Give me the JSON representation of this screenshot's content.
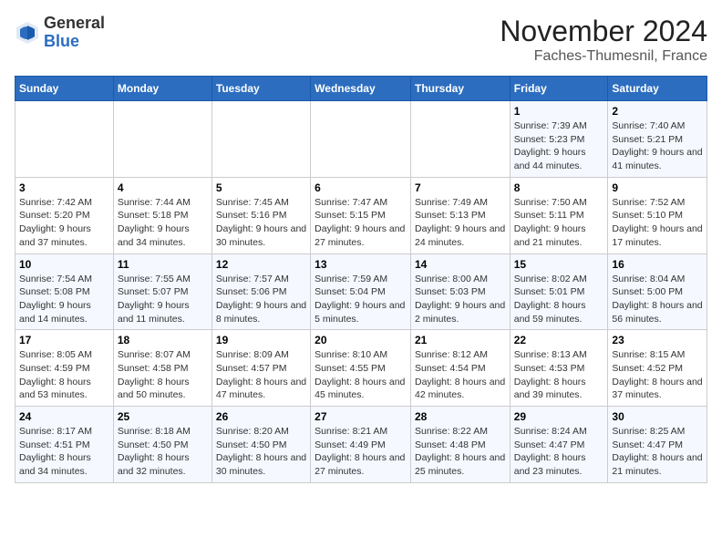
{
  "header": {
    "logo_general": "General",
    "logo_blue": "Blue",
    "month_title": "November 2024",
    "location": "Faches-Thumesnil, France"
  },
  "days_of_week": [
    "Sunday",
    "Monday",
    "Tuesday",
    "Wednesday",
    "Thursday",
    "Friday",
    "Saturday"
  ],
  "weeks": [
    [
      {
        "day": "",
        "info": ""
      },
      {
        "day": "",
        "info": ""
      },
      {
        "day": "",
        "info": ""
      },
      {
        "day": "",
        "info": ""
      },
      {
        "day": "",
        "info": ""
      },
      {
        "day": "1",
        "info": "Sunrise: 7:39 AM\nSunset: 5:23 PM\nDaylight: 9 hours and 44 minutes."
      },
      {
        "day": "2",
        "info": "Sunrise: 7:40 AM\nSunset: 5:21 PM\nDaylight: 9 hours and 41 minutes."
      }
    ],
    [
      {
        "day": "3",
        "info": "Sunrise: 7:42 AM\nSunset: 5:20 PM\nDaylight: 9 hours and 37 minutes."
      },
      {
        "day": "4",
        "info": "Sunrise: 7:44 AM\nSunset: 5:18 PM\nDaylight: 9 hours and 34 minutes."
      },
      {
        "day": "5",
        "info": "Sunrise: 7:45 AM\nSunset: 5:16 PM\nDaylight: 9 hours and 30 minutes."
      },
      {
        "day": "6",
        "info": "Sunrise: 7:47 AM\nSunset: 5:15 PM\nDaylight: 9 hours and 27 minutes."
      },
      {
        "day": "7",
        "info": "Sunrise: 7:49 AM\nSunset: 5:13 PM\nDaylight: 9 hours and 24 minutes."
      },
      {
        "day": "8",
        "info": "Sunrise: 7:50 AM\nSunset: 5:11 PM\nDaylight: 9 hours and 21 minutes."
      },
      {
        "day": "9",
        "info": "Sunrise: 7:52 AM\nSunset: 5:10 PM\nDaylight: 9 hours and 17 minutes."
      }
    ],
    [
      {
        "day": "10",
        "info": "Sunrise: 7:54 AM\nSunset: 5:08 PM\nDaylight: 9 hours and 14 minutes."
      },
      {
        "day": "11",
        "info": "Sunrise: 7:55 AM\nSunset: 5:07 PM\nDaylight: 9 hours and 11 minutes."
      },
      {
        "day": "12",
        "info": "Sunrise: 7:57 AM\nSunset: 5:06 PM\nDaylight: 9 hours and 8 minutes."
      },
      {
        "day": "13",
        "info": "Sunrise: 7:59 AM\nSunset: 5:04 PM\nDaylight: 9 hours and 5 minutes."
      },
      {
        "day": "14",
        "info": "Sunrise: 8:00 AM\nSunset: 5:03 PM\nDaylight: 9 hours and 2 minutes."
      },
      {
        "day": "15",
        "info": "Sunrise: 8:02 AM\nSunset: 5:01 PM\nDaylight: 8 hours and 59 minutes."
      },
      {
        "day": "16",
        "info": "Sunrise: 8:04 AM\nSunset: 5:00 PM\nDaylight: 8 hours and 56 minutes."
      }
    ],
    [
      {
        "day": "17",
        "info": "Sunrise: 8:05 AM\nSunset: 4:59 PM\nDaylight: 8 hours and 53 minutes."
      },
      {
        "day": "18",
        "info": "Sunrise: 8:07 AM\nSunset: 4:58 PM\nDaylight: 8 hours and 50 minutes."
      },
      {
        "day": "19",
        "info": "Sunrise: 8:09 AM\nSunset: 4:57 PM\nDaylight: 8 hours and 47 minutes."
      },
      {
        "day": "20",
        "info": "Sunrise: 8:10 AM\nSunset: 4:55 PM\nDaylight: 8 hours and 45 minutes."
      },
      {
        "day": "21",
        "info": "Sunrise: 8:12 AM\nSunset: 4:54 PM\nDaylight: 8 hours and 42 minutes."
      },
      {
        "day": "22",
        "info": "Sunrise: 8:13 AM\nSunset: 4:53 PM\nDaylight: 8 hours and 39 minutes."
      },
      {
        "day": "23",
        "info": "Sunrise: 8:15 AM\nSunset: 4:52 PM\nDaylight: 8 hours and 37 minutes."
      }
    ],
    [
      {
        "day": "24",
        "info": "Sunrise: 8:17 AM\nSunset: 4:51 PM\nDaylight: 8 hours and 34 minutes."
      },
      {
        "day": "25",
        "info": "Sunrise: 8:18 AM\nSunset: 4:50 PM\nDaylight: 8 hours and 32 minutes."
      },
      {
        "day": "26",
        "info": "Sunrise: 8:20 AM\nSunset: 4:50 PM\nDaylight: 8 hours and 30 minutes."
      },
      {
        "day": "27",
        "info": "Sunrise: 8:21 AM\nSunset: 4:49 PM\nDaylight: 8 hours and 27 minutes."
      },
      {
        "day": "28",
        "info": "Sunrise: 8:22 AM\nSunset: 4:48 PM\nDaylight: 8 hours and 25 minutes."
      },
      {
        "day": "29",
        "info": "Sunrise: 8:24 AM\nSunset: 4:47 PM\nDaylight: 8 hours and 23 minutes."
      },
      {
        "day": "30",
        "info": "Sunrise: 8:25 AM\nSunset: 4:47 PM\nDaylight: 8 hours and 21 minutes."
      }
    ]
  ]
}
